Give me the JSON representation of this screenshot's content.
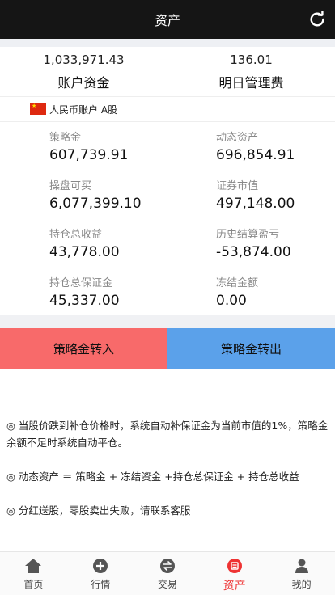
{
  "header": {
    "title": "资产",
    "refresh_icon": "refresh-icon"
  },
  "summary": {
    "funds_value": "1,033,971.43",
    "funds_label": "账户资金",
    "fee_value": "136.01",
    "fee_label": "明日管理费"
  },
  "account": {
    "name": "人民币账户 A股",
    "flag_icon": "china-flag-icon"
  },
  "stats": [
    {
      "label": "策略金",
      "value": "607,739.91"
    },
    {
      "label": "动态资产",
      "value": "696,854.91"
    },
    {
      "label": "操盘可买",
      "value": "6,077,399.10"
    },
    {
      "label": "证券市值",
      "value": "497,148.00"
    },
    {
      "label": "持仓总收益",
      "value": "43,778.00"
    },
    {
      "label": "历史结算盈亏",
      "value": "-53,874.00"
    },
    {
      "label": "持仓总保证金",
      "value": "45,337.00"
    },
    {
      "label": "冻结金额",
      "value": "0.00"
    }
  ],
  "buttons": {
    "transfer_in": "策略金转入",
    "transfer_out": "策略金转出"
  },
  "notes": [
    "◎ 当股价跌到补仓价格时，系统自动补保证金为当前市值的1%，策略金余额不足时系统自动平仓。",
    "◎ 动态资产 ＝ 策略金 + 冻结资金 +持仓总保证金 + 持仓总收益",
    "◎ 分红送股，零股卖出失败，请联系客服"
  ],
  "tabs": [
    {
      "label": "首页",
      "icon": "home-icon"
    },
    {
      "label": "行情",
      "icon": "market-icon"
    },
    {
      "label": "交易",
      "icon": "exchange-icon"
    },
    {
      "label": "资产",
      "icon": "assets-icon",
      "active": true
    },
    {
      "label": "我的",
      "icon": "user-icon"
    }
  ],
  "colors": {
    "accent": "#e33333",
    "transfer_in_bg": "#f86a6a",
    "transfer_out_bg": "#5ba1ea",
    "header_bg": "#151515"
  }
}
